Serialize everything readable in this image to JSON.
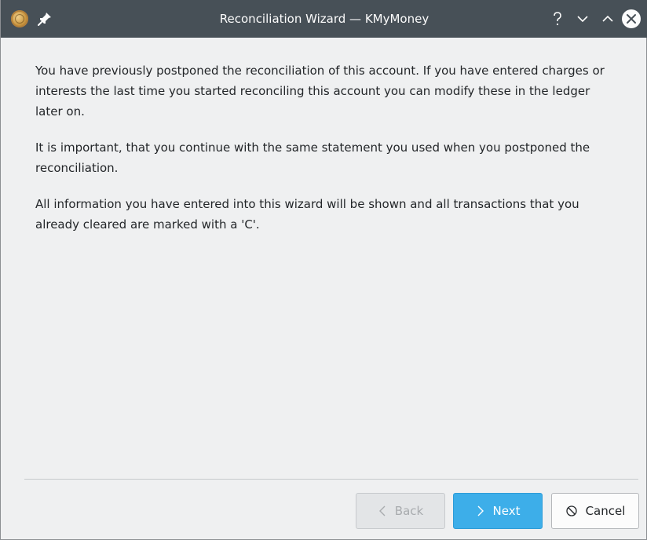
{
  "window": {
    "title": "Reconciliation Wizard — KMyMoney"
  },
  "titlebar": {
    "app_icon": "kmymoney-coin-icon",
    "pin_icon": "pin-icon",
    "help_label": "?",
    "buttons": [
      "help-icon",
      "minimize-icon",
      "maximize-icon",
      "close-icon"
    ]
  },
  "body": {
    "paragraph1": "You have previously postponed the reconciliation of this account. If you have entered charges or interests the last time you started reconciling this account you can modify these in the ledger later on.",
    "paragraph2": "It is important, that you continue with the same statement you used when you postponed the reconciliation.",
    "paragraph3": "All information you have entered into this wizard will be shown and all transactions that you already cleared are marked with a 'C'."
  },
  "footer": {
    "back_label": "Back",
    "next_label": "Next",
    "cancel_label": "Cancel",
    "back_enabled": false
  },
  "colors": {
    "titlebar": "#475057",
    "background": "#eff0f1",
    "accent": "#3daee9",
    "text": "#232629"
  }
}
